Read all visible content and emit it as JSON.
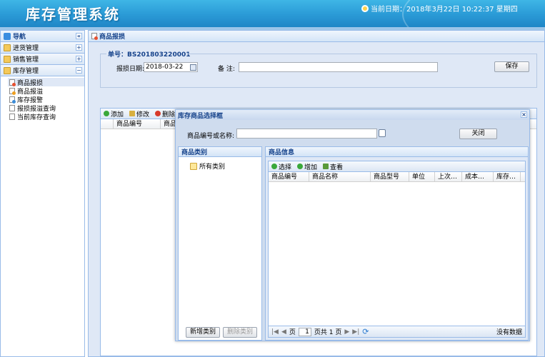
{
  "header": {
    "title": "库存管理系统",
    "clock": "当前日期：2018年3月22日 10:22:37 星期四"
  },
  "sidebar": {
    "title": "导航",
    "collapse": "«",
    "sections": [
      {
        "label": "进货管理",
        "toggle": "+"
      },
      {
        "label": "销售管理",
        "toggle": "+"
      },
      {
        "label": "库存管理",
        "toggle": "−"
      }
    ],
    "items": [
      "商品报损",
      "商品报溢",
      "库存报警",
      "报损报溢查询",
      "当前库存查询"
    ]
  },
  "main": {
    "tab": "商品报损",
    "order": "单号：BS201803220001",
    "date_label": "报损日期:",
    "date": "2018-03-22",
    "note_label": "备 注:",
    "note": "",
    "save": "保存",
    "toolbar": [
      "添加",
      "修改",
      "删除"
    ],
    "columns": [
      "商品编号",
      "商品"
    ]
  },
  "dialog": {
    "title": "库存商品选择框",
    "close_x": "×",
    "search_label": "商品编号或名称:",
    "search_value": "",
    "close": "关闭",
    "category": {
      "title": "商品类别",
      "root": "所有类别",
      "add": "新增类别",
      "del": "删除类别"
    },
    "info": {
      "title": "商品信息",
      "toolbar": [
        "选择",
        "增加",
        "查看"
      ],
      "columns": [
        "商品编号",
        "商品名称",
        "商品型号",
        "单位",
        "上次…",
        "成本…",
        "库存…"
      ],
      "pager": {
        "page_prefix": "页",
        "page": "1",
        "page_suffix": "页共 1 页",
        "empty": "没有数据"
      }
    }
  }
}
